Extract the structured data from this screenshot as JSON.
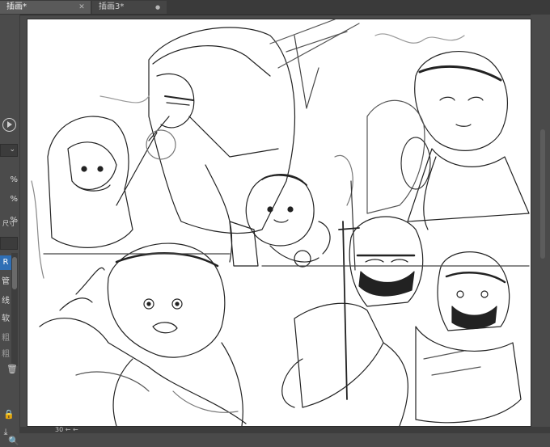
{
  "tabs": [
    {
      "label": "插画*",
      "close_icon": "close-icon",
      "active": true
    },
    {
      "label": "插画3*",
      "close_icon": "unsaved-dot-icon",
      "active": false
    }
  ],
  "left_panel": {
    "labels": [
      "尺寸",
      "R",
      "管",
      "线",
      "软",
      "粗",
      "粗"
    ],
    "spin_values": [
      "%",
      "%",
      "%"
    ],
    "play_icon": "play-circle-icon",
    "delete_icon": "trash-icon",
    "lock_icon": "lock-icon",
    "download_icon": "download-icon",
    "search_icon": "search-icon"
  },
  "status": {
    "zoom_text": "30 ← ←"
  },
  "canvas": {
    "content": "pencil-sketch-illustration"
  }
}
